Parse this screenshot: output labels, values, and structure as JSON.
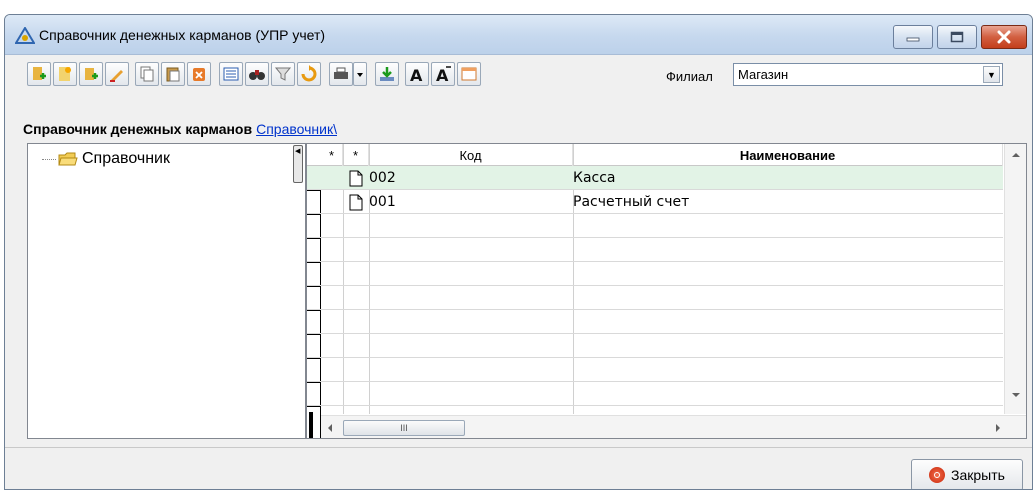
{
  "window": {
    "title": "Справочник денежных карманов (УПР учет)"
  },
  "toolbar": {
    "filial_label": "Филиал",
    "filial_value": "Магазин",
    "buttons": [
      "add-green",
      "add-new",
      "add-group",
      "edit",
      "copy",
      "paste",
      "delete",
      "list-view",
      "find",
      "filter",
      "refresh",
      "print",
      "print-dropdown",
      "export",
      "font-increase",
      "font-decrease",
      "layout"
    ]
  },
  "breadcrumb": {
    "title": "Справочник денежных карманов",
    "link": "Справочник\\"
  },
  "tree": {
    "root_label": "Справочник"
  },
  "grid": {
    "headers": {
      "mark1": "*",
      "mark2": "*",
      "code": "Код",
      "name": "Наименование"
    },
    "rows": [
      {
        "code": "002",
        "name": "Касса"
      },
      {
        "code": "001",
        "name": "Расчетный счет"
      }
    ],
    "hscroll_grip": "III"
  },
  "footer": {
    "close_label": "Закрыть"
  }
}
